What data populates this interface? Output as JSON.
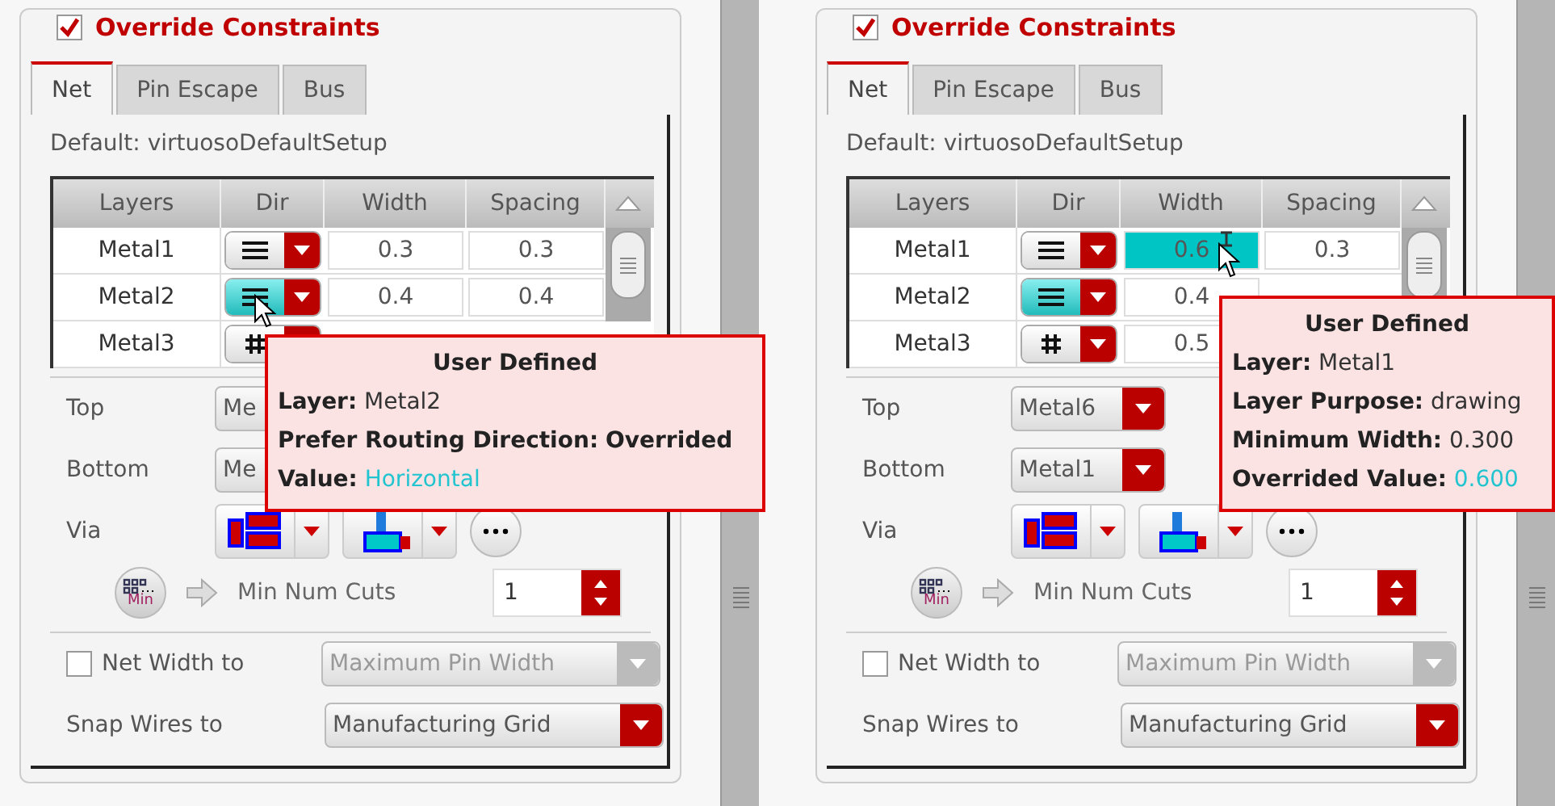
{
  "panels": [
    {
      "override": {
        "label": "Override Constraints",
        "checked": true
      },
      "tabs": [
        {
          "label": "Net",
          "selected": true
        },
        {
          "label": "Pin Escape",
          "selected": false
        },
        {
          "label": "Bus",
          "selected": false
        }
      ],
      "default_text": "Default: virtuosoDefaultSetup",
      "table": {
        "columns": [
          "Layers",
          "Dir",
          "Width",
          "Spacing"
        ],
        "rows": [
          {
            "layer": "Metal1",
            "dir": {
              "kind": "horizontal",
              "highlighted": false,
              "hovered": false
            },
            "width": {
              "text": "0.3",
              "selected": false,
              "hovered": false
            },
            "spacing": "0.3"
          },
          {
            "layer": "Metal2",
            "dir": {
              "kind": "horizontal",
              "highlighted": true,
              "hovered": true
            },
            "width": {
              "text": "0.4",
              "selected": false,
              "hovered": false
            },
            "spacing": "0.4"
          },
          {
            "layer": "Metal3",
            "dir": {
              "kind": "grid",
              "highlighted": false,
              "hovered": false
            }
          }
        ]
      },
      "top": {
        "label": "Top",
        "value": "Me"
      },
      "bottom": {
        "label": "Bottom",
        "value": "Me"
      },
      "via_label": "Via",
      "min_icon_label": "Min",
      "min_cuts": {
        "label": "Min Num Cuts",
        "value": "1"
      },
      "net_width": {
        "label": "Net Width to",
        "checked": false,
        "value": "Maximum Pin Width",
        "disabled": true
      },
      "snap": {
        "label": "Snap Wires to",
        "value": "Manufacturing Grid",
        "disabled": false
      },
      "tooltip": {
        "title": "User Defined",
        "lines": [
          {
            "label": "Layer:",
            "value": "Metal2",
            "kind": "field"
          },
          {
            "label": "Prefer Routing Direction:",
            "value": "Overrided",
            "kind": "status"
          },
          {
            "label": "Value:",
            "value": "Horizontal",
            "kind": "override"
          }
        ]
      }
    },
    {
      "override": {
        "label": "Override Constraints",
        "checked": true
      },
      "tabs": [
        {
          "label": "Net",
          "selected": true
        },
        {
          "label": "Pin Escape",
          "selected": false
        },
        {
          "label": "Bus",
          "selected": false
        }
      ],
      "default_text": "Default: virtuosoDefaultSetup",
      "table": {
        "columns": [
          "Layers",
          "Dir",
          "Width",
          "Spacing"
        ],
        "rows": [
          {
            "layer": "Metal1",
            "dir": {
              "kind": "horizontal",
              "highlighted": false,
              "hovered": false
            },
            "width": {
              "text": "0.6",
              "selected": true,
              "hovered": true
            },
            "spacing": "0.3"
          },
          {
            "layer": "Metal2",
            "dir": {
              "kind": "horizontal",
              "highlighted": true,
              "hovered": false
            },
            "width": {
              "text": "0.4",
              "selected": false,
              "hovered": false
            }
          },
          {
            "layer": "Metal3",
            "dir": {
              "kind": "grid",
              "highlighted": false,
              "hovered": false
            },
            "width": {
              "text": "0.5",
              "selected": false,
              "hovered": false
            }
          }
        ]
      },
      "top": {
        "label": "Top",
        "value": "Metal6"
      },
      "bottom": {
        "label": "Bottom",
        "value": "Metal1"
      },
      "via_label": "Via",
      "min_icon_label": "Min",
      "min_cuts": {
        "label": "Min Num Cuts",
        "value": "1"
      },
      "net_width": {
        "label": "Net Width to",
        "checked": false,
        "value": "Maximum Pin Width",
        "disabled": true
      },
      "snap": {
        "label": "Snap Wires to",
        "value": "Manufacturing Grid",
        "disabled": false
      },
      "tooltip": {
        "title": "User Defined",
        "lines": [
          {
            "label": "Layer:",
            "value": "Metal1",
            "kind": "field"
          },
          {
            "label": "Layer Purpose:",
            "value": "drawing",
            "kind": "field"
          },
          {
            "label": "Minimum Width:",
            "value": "0.300",
            "kind": "field"
          },
          {
            "label": "Overrided Value:",
            "value": "0.600",
            "kind": "override"
          }
        ]
      }
    }
  ]
}
